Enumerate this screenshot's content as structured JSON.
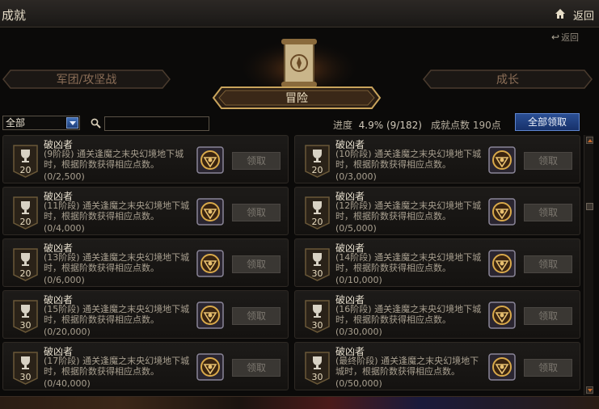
{
  "window": {
    "title": "成就",
    "back_label": "返回"
  },
  "sub_back_label": "返回",
  "tabs": {
    "left": "军团/攻坚战",
    "center": "冒险",
    "right": "成长"
  },
  "filter": {
    "selected": "全部",
    "search_placeholder": ""
  },
  "summary": {
    "progress_label": "进度",
    "progress_value": "4.9% (9/182)",
    "points_label": "成就点数",
    "points_value": "190点",
    "claim_all_label": "全部领取"
  },
  "colors": {
    "accent_blue": "#2b4f94",
    "gold": "#c9a45c",
    "background": "#0b0a09"
  },
  "achievements": [
    {
      "name": "破凶者",
      "desc": "(9阶段) 通关逢魔之末央幻境地下城时，根据阶数获得相应点数。",
      "progress": "(0/2,500)",
      "points": "20",
      "button": "领取"
    },
    {
      "name": "破凶者",
      "desc": "(10阶段) 通关逢魔之末央幻境地下城时，根据阶数获得相应点数。",
      "progress": "(0/3,000)",
      "points": "20",
      "button": "领取"
    },
    {
      "name": "破凶者",
      "desc": "(11阶段) 通关逢魔之末央幻境地下城时，根据阶数获得相应点数。",
      "progress": "(0/4,000)",
      "points": "20",
      "button": "领取"
    },
    {
      "name": "破凶者",
      "desc": "(12阶段) 通关逢魔之末央幻境地下城时，根据阶数获得相应点数。",
      "progress": "(0/5,000)",
      "points": "20",
      "button": "领取"
    },
    {
      "name": "破凶者",
      "desc": "(13阶段) 通关逢魔之末央幻境地下城时，根据阶数获得相应点数。",
      "progress": "(0/6,000)",
      "points": "20",
      "button": "领取"
    },
    {
      "name": "破凶者",
      "desc": "(14阶段) 通关逢魔之末央幻境地下城时，根据阶数获得相应点数。",
      "progress": "(0/10,000)",
      "points": "30",
      "button": "领取"
    },
    {
      "name": "破凶者",
      "desc": "(15阶段) 通关逢魔之末央幻境地下城时，根据阶数获得相应点数。",
      "progress": "(0/20,000)",
      "points": "30",
      "button": "领取"
    },
    {
      "name": "破凶者",
      "desc": "(16阶段) 通关逢魔之末央幻境地下城时，根据阶数获得相应点数。",
      "progress": "(0/30,000)",
      "points": "30",
      "button": "领取"
    },
    {
      "name": "破凶者",
      "desc": "(17阶段) 通关逢魔之末央幻境地下城时，根据阶数获得相应点数。",
      "progress": "(0/40,000)",
      "points": "30",
      "button": "领取"
    },
    {
      "name": "破凶者",
      "desc": "(最终阶段) 通关逢魔之末央幻境地下城时，根据阶数获得相应点数。",
      "progress": "(0/50,000)",
      "points": "30",
      "button": "领取"
    }
  ]
}
